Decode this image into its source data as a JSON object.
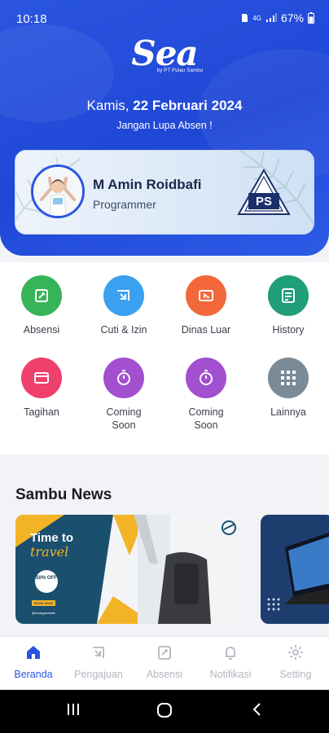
{
  "status_bar": {
    "time": "10:18",
    "network": "4G",
    "battery": "67%"
  },
  "header": {
    "logo_text": "Sea",
    "logo_subtitle": "by PT Pulau Sambu",
    "date_prefix": "Kamis,",
    "date_main": "22 Februari 2024",
    "reminder": "Jangan Lupa Absen !"
  },
  "profile": {
    "name": "M Amin Roidbafi",
    "role": "Programmer",
    "company_logo_text": "PS"
  },
  "menu": {
    "items": [
      {
        "label": "Absensi",
        "icon": "attendance-icon",
        "color": "#37b45a"
      },
      {
        "label": "Cuti & Izin",
        "icon": "leave-icon",
        "color": "#3aa0f0"
      },
      {
        "label": "Dinas Luar",
        "icon": "business-trip-icon",
        "color": "#f2683a"
      },
      {
        "label": "History",
        "icon": "history-icon",
        "color": "#1f9e78"
      },
      {
        "label": "Tagihan",
        "icon": "bill-icon",
        "color": "#ef3f6b"
      },
      {
        "label": "Coming Soon",
        "icon": "timer-icon",
        "color": "#a24fd0"
      },
      {
        "label": "Coming Soon",
        "icon": "timer-icon",
        "color": "#a24fd0"
      },
      {
        "label": "Lainnya",
        "icon": "grid-icon",
        "color": "#7b8a97"
      }
    ]
  },
  "news": {
    "section_title": "Sambu News",
    "card1": {
      "title": "Time to",
      "script": "travel",
      "badge": "50% OFF",
      "button": "BOOK NOW",
      "handle": "@reallygreatsite"
    }
  },
  "bottom_nav": {
    "items": [
      {
        "label": "Beranda",
        "active": true
      },
      {
        "label": "Pengajuan",
        "active": false
      },
      {
        "label": "Absensi",
        "active": false
      },
      {
        "label": "Notifikasi",
        "active": false
      },
      {
        "label": "Setting",
        "active": false
      }
    ]
  },
  "colors": {
    "primary": "#2a55e0",
    "header_bg": "#1f47d6",
    "nav_inactive": "#b2b6bf"
  }
}
